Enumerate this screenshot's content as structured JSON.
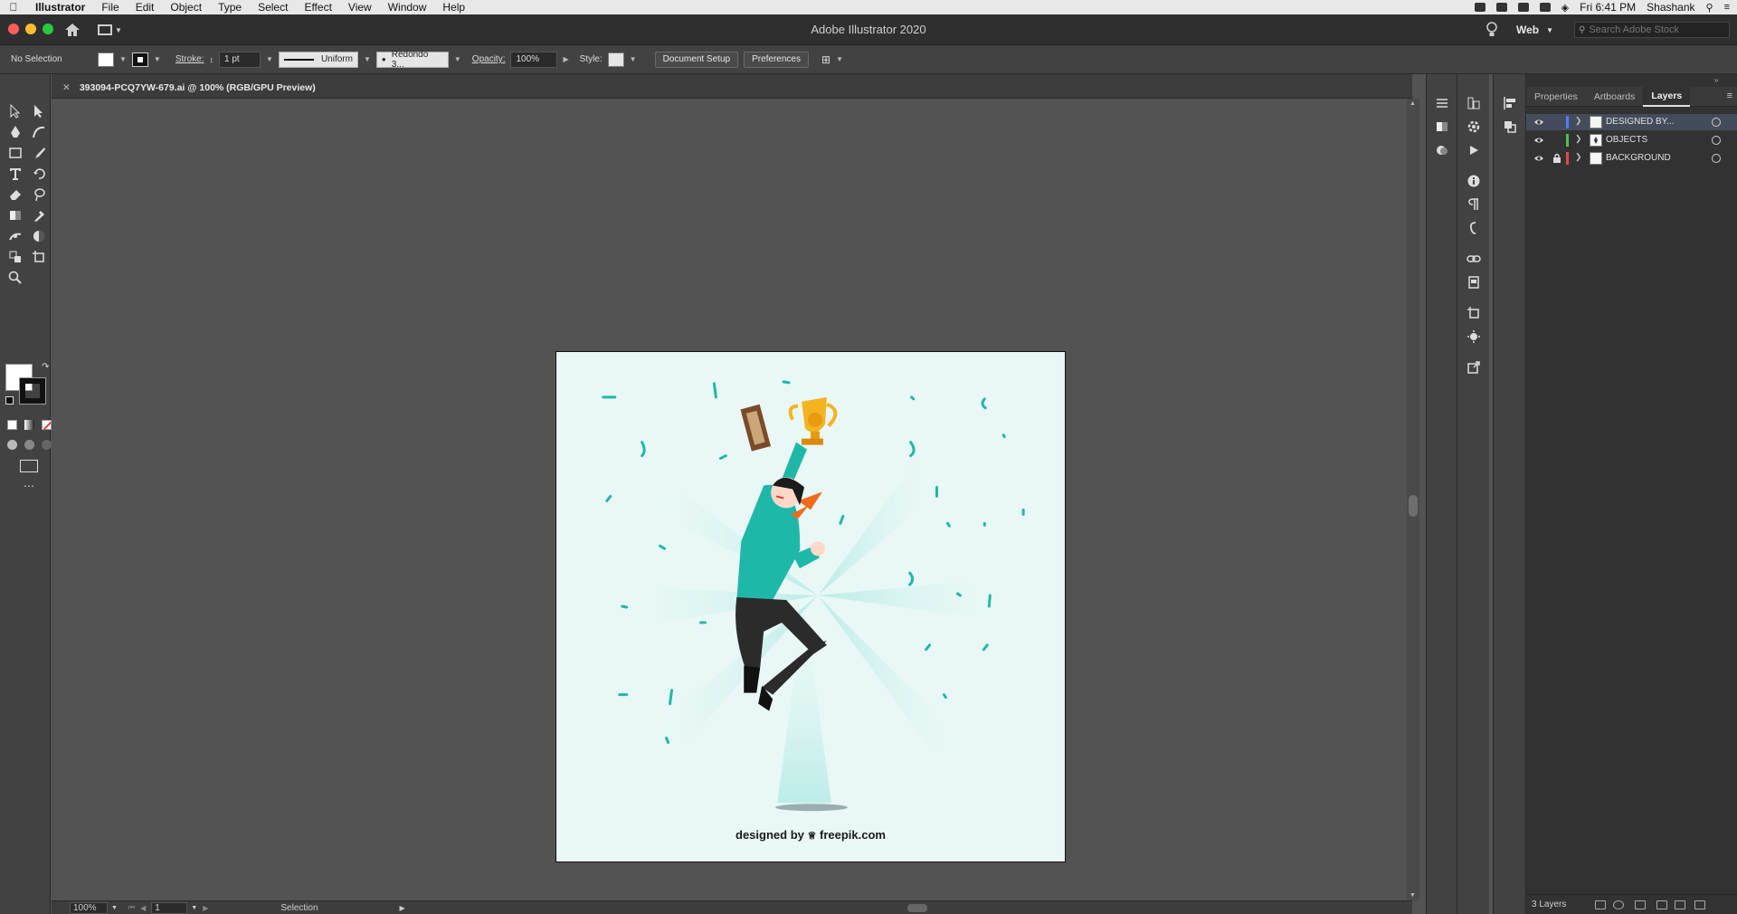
{
  "menubar": {
    "apple": "",
    "items": [
      "Illustrator",
      "File",
      "Edit",
      "Object",
      "Type",
      "Select",
      "Effect",
      "View",
      "Window",
      "Help"
    ],
    "clock": "Fri 6:41 PM",
    "user": "Shashank"
  },
  "titlebar": {
    "title": "Adobe Illustrator 2020",
    "workspace": "Web",
    "stock_placeholder": "Search Adobe Stock"
  },
  "controlbar": {
    "selection": "No Selection",
    "stroke_label": "Stroke:",
    "stroke_weight": "1 pt",
    "profile": "Uniform",
    "brush": "Redondo 3...",
    "opacity_label": "Opacity:",
    "opacity": "100%",
    "style_label": "Style:",
    "document_setup": "Document Setup",
    "preferences": "Preferences"
  },
  "document": {
    "tab": "393094-PCQ7YW-679.ai @ 100% (RGB/GPU Preview)",
    "zoom": "100%",
    "artboard_number": "1",
    "tool_mode": "Selection",
    "credit_prefix": "designed by",
    "credit_brand": "freepik.com"
  },
  "panel": {
    "tabs": [
      "Properties",
      "Artboards",
      "Layers"
    ],
    "active_tab": "Layers",
    "layers": [
      {
        "name": "DESIGNED BY...",
        "color": "#4f7cff",
        "locked": false,
        "selected": true
      },
      {
        "name": "OBJECTS",
        "color": "#4ec24e",
        "locked": false,
        "selected": false
      },
      {
        "name": "BACKGROUND",
        "color": "#e04a4a",
        "locked": true,
        "selected": false
      }
    ],
    "footer_count": "3 Layers"
  },
  "colors": {
    "ui_dark": "#323232",
    "ui_mid": "#424242",
    "canvas": "#535353",
    "artboard_bg": "#e9f8f6",
    "accent_teal": "#1fb8a8"
  }
}
